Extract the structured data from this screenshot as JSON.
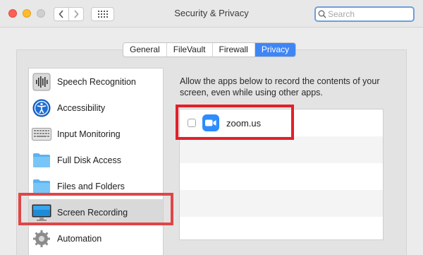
{
  "window": {
    "title": "Security & Privacy"
  },
  "search": {
    "placeholder": "Search"
  },
  "tabs": [
    {
      "label": "General",
      "active": false
    },
    {
      "label": "FileVault",
      "active": false
    },
    {
      "label": "Firewall",
      "active": false
    },
    {
      "label": "Privacy",
      "active": true
    }
  ],
  "sidebar": {
    "items": [
      {
        "label": "Speech Recognition",
        "icon": "waveform-icon"
      },
      {
        "label": "Accessibility",
        "icon": "accessibility-icon"
      },
      {
        "label": "Input Monitoring",
        "icon": "keyboard-icon"
      },
      {
        "label": "Full Disk Access",
        "icon": "folder-icon"
      },
      {
        "label": "Files and Folders",
        "icon": "folder-icon"
      },
      {
        "label": "Screen Recording",
        "icon": "display-icon",
        "selected": true
      },
      {
        "label": "Automation",
        "icon": "gear-icon"
      }
    ]
  },
  "main": {
    "description": "Allow the apps below to record the contents of your screen, even while using other apps.",
    "apps": [
      {
        "name": "zoom.us",
        "checked": false,
        "icon": "zoom-video-icon"
      }
    ]
  },
  "colors": {
    "accent": "#3f86f5",
    "highlight": "#e2202a",
    "zoom": "#2d8cff"
  }
}
